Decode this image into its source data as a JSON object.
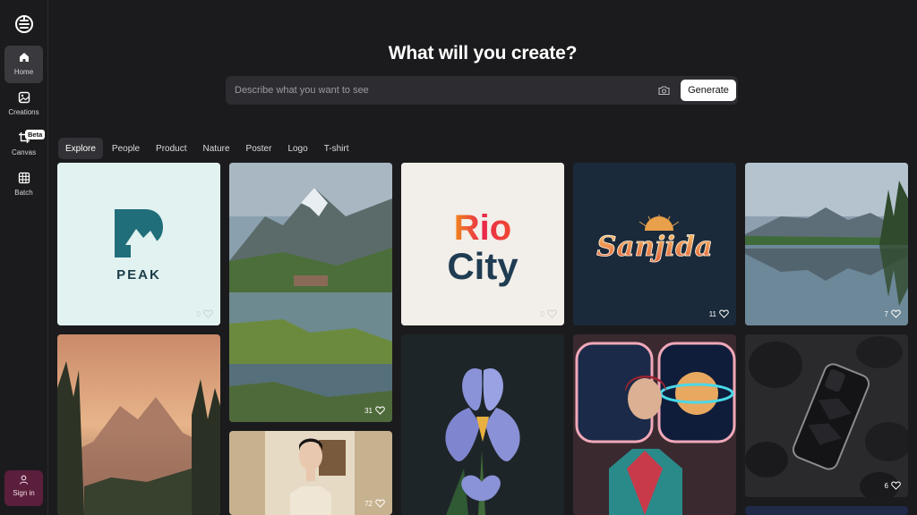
{
  "sidebar": {
    "items": [
      {
        "label": "Home",
        "icon": "home-icon",
        "active": true
      },
      {
        "label": "Creations",
        "icon": "image-icon"
      },
      {
        "label": "Canvas",
        "icon": "crop-icon",
        "badge": "Beta"
      },
      {
        "label": "Batch",
        "icon": "grid-icon"
      }
    ],
    "signin_label": "Sign in"
  },
  "header": {
    "title": "What will you create?"
  },
  "search": {
    "placeholder": "Describe what you want to see",
    "generate_label": "Generate"
  },
  "tabs": [
    "Explore",
    "People",
    "Product",
    "Nature",
    "Poster",
    "Logo",
    "T-shirt"
  ],
  "gallery": [
    {
      "name": "peak-logo",
      "text": "PEAK",
      "likes": "0"
    },
    {
      "name": "mountain-lake-cabin",
      "likes": "31"
    },
    {
      "name": "rio-city-logo",
      "text_line1": "Rio",
      "text_line2": "City",
      "likes": "0"
    },
    {
      "name": "sanjida-logo",
      "text": "Sanjida",
      "likes": "11"
    },
    {
      "name": "mountain-lake-reflection",
      "likes": "7"
    },
    {
      "name": "sunset-mountain-forest",
      "likes": ""
    },
    {
      "name": "portrait-hanbok",
      "likes": "72"
    },
    {
      "name": "iris-flower",
      "likes": ""
    },
    {
      "name": "retro-space-woman",
      "likes": ""
    },
    {
      "name": "phone-case-rocks",
      "likes": "6"
    }
  ],
  "colors": {
    "accent_signin": "#5b1f3c",
    "background": "#1b1b1d",
    "active_nav": "#3a3a3e"
  }
}
